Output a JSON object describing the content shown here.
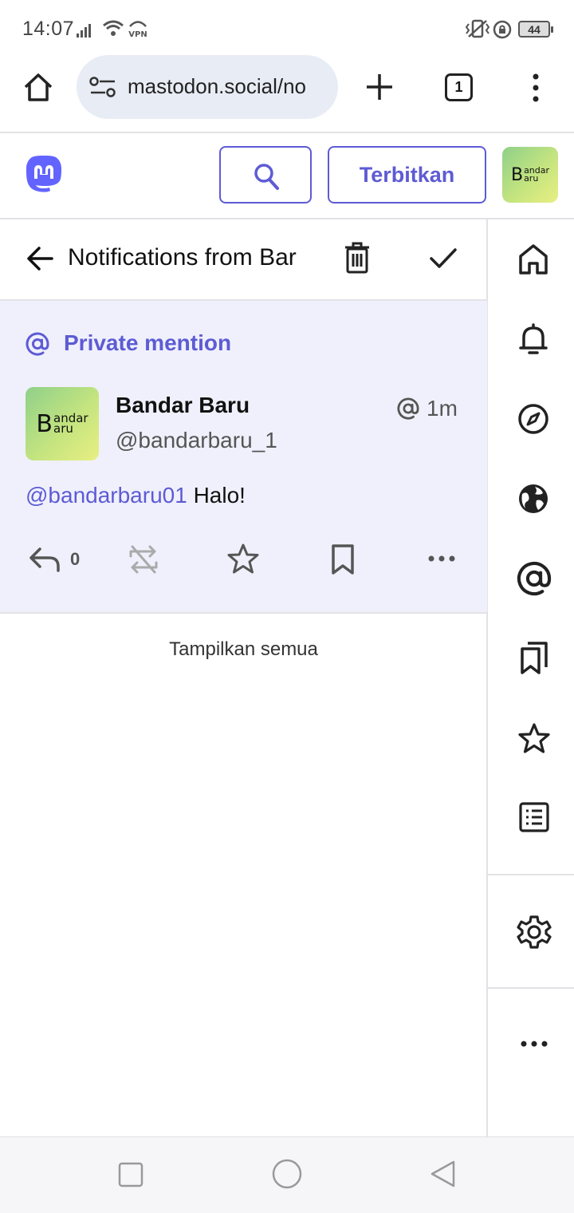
{
  "status_bar": {
    "time": "14:07",
    "battery": "44"
  },
  "browser": {
    "url": "mastodon.social/no",
    "tab_count": "1"
  },
  "header": {
    "publish_label": "Terbitkan",
    "avatar_text_big": "B",
    "avatar_text_top": "andar",
    "avatar_text_bottom": "aru"
  },
  "column": {
    "title": "Notifications from Bar"
  },
  "notification": {
    "type_label": "Private mention",
    "display_name": "Bandar Baru",
    "handle": "@bandarbaru_1",
    "time_ago": "1m",
    "body_mention": "@bandarbaru01",
    "body_text": " Halo!",
    "reply_count": "0"
  },
  "show_all_label": "Tampilkan semua",
  "colors": {
    "accent": "#5d5bd4",
    "card_bg": "#f0f0fd"
  },
  "sidebar_icons": [
    "home-icon",
    "bell-icon",
    "compass-icon",
    "globe-icon",
    "at-icon",
    "bookmarks-icon",
    "star-icon",
    "list-icon",
    "gear-icon",
    "more-icon"
  ]
}
